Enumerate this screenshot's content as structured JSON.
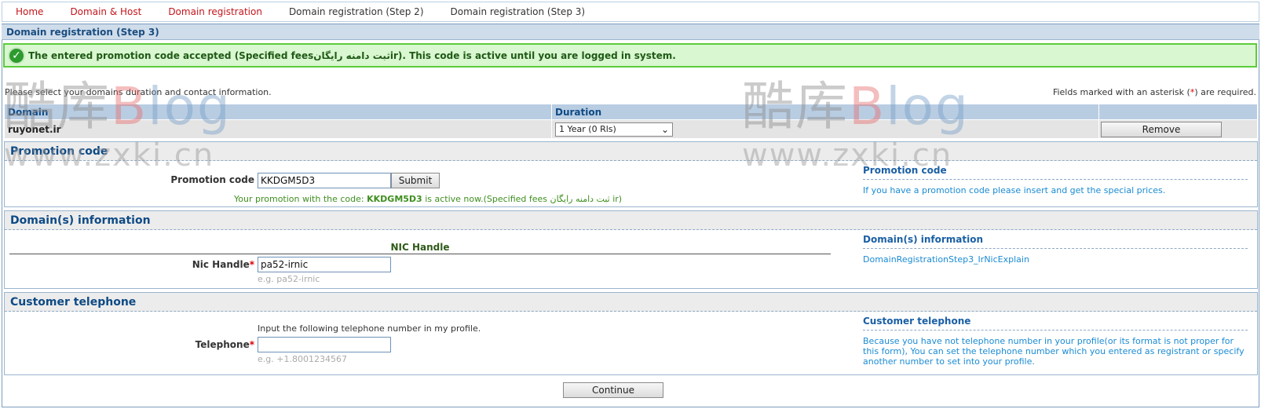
{
  "nav": [
    {
      "label": "Home",
      "color": "red"
    },
    {
      "label": "Domain & Host",
      "color": "red"
    },
    {
      "label": "Domain registration",
      "color": "red"
    },
    {
      "label": "Domain registration (Step 2)",
      "color": "dark"
    },
    {
      "label": "Domain registration (Step 3)",
      "color": "dark"
    }
  ],
  "page": {
    "title": "Domain registration (Step 3)"
  },
  "alert": {
    "icon": "check-circle-icon",
    "text": "The entered promotion code accepted (Specified feesثبت دامنه رایگانir). This code is active until you are logged in system."
  },
  "intro": {
    "left": "Please select your domains duration and contact information.",
    "right_before": "Fields marked with an asterisk (",
    "star": "*",
    "right_after": ") are required."
  },
  "domains_table": {
    "headers": {
      "domain": "Domain",
      "duration": "Duration"
    },
    "rows": [
      {
        "domain": "ruyonet.ir",
        "duration": "1 Year (0 Rls)",
        "remove": "Remove"
      }
    ]
  },
  "promotion": {
    "heading": "Promotion code",
    "label": "Promotion code",
    "value": "KKDGM5D3",
    "submit": "Submit",
    "active_prefix": "Your promotion with the code: ",
    "active_code": "KKDGM5D3",
    "active_suffix": " is active now.(Specified fees ثبت دامنه رایگان ir)",
    "side_title": "Promotion code",
    "side_text": "If you have a promotion code please insert and get the special prices."
  },
  "domain_info": {
    "heading": "Domain(s) information",
    "subheading": "NIC Handle",
    "label": "Nic Handle",
    "star": "*",
    "value": "pa52-irnic",
    "hint": "e.g. pa52-irnic",
    "side_title": "Domain(s) information",
    "side_text": "DomainRegistrationStep3_IrNicExplain"
  },
  "telephone": {
    "heading": "Customer telephone",
    "note": "Input the following telephone number in my profile.",
    "label": "Telephone",
    "star": "*",
    "value": "",
    "hint": "e.g. +1.8001234567",
    "side_title": "Customer telephone",
    "side_text": "Because you have not telephone number in your profile(or its format is not proper for this form), You can set the telephone number which you entered as registrant or specify another number to set into your profile."
  },
  "continue_label": "Continue",
  "watermark": {
    "left_cn": "酷库",
    "b": "B",
    "log": "log",
    "url": "www.zxki.cn"
  },
  "colors": {
    "nav_red": "#c4161c",
    "alert_bg": "#d9f7d0",
    "alert_border": "#5ccc3c",
    "link_blue": "#1a8bd3",
    "header_blue": "#0e4a85"
  }
}
